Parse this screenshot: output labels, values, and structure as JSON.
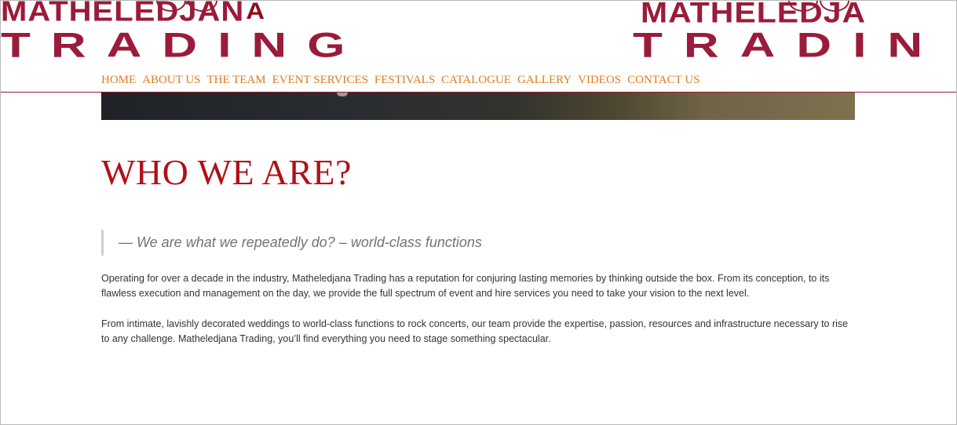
{
  "header": {
    "logo_top_text": "MATHELEDJAN",
    "logo_top_last_letter": "A",
    "logo_bottom_text": "TRADING",
    "logo_repeat_top_text": "MATHELEDJA",
    "logo_repeat_bottom_text": "TRADIN",
    "brand_color": "#9a1b3a"
  },
  "nav": {
    "color": "#e07b1e",
    "items": [
      {
        "label": "HOME"
      },
      {
        "label": "ABOUT US"
      },
      {
        "label": "THE TEAM"
      },
      {
        "label": "EVENT SERVICES"
      },
      {
        "label": "FESTIVALS"
      },
      {
        "label": "CATALOGUE"
      },
      {
        "label": "GALLERY"
      },
      {
        "label": "VIDEOS"
      },
      {
        "label": "CONTACT US"
      }
    ]
  },
  "main": {
    "title": "WHO WE ARE?",
    "title_color": "#b01018",
    "quote": "— We are what we repeatedly do? – world-class functions",
    "paragraphs": [
      "Operating for over a decade in the industry, Matheledjana Trading has a reputation for conjuring lasting memories by thinking outside the box. From its conception, to its flawless execution and management on the day, we provide the full spectrum of event and hire services you need to take your vision to the next level.",
      "From intimate, lavishly decorated weddings to world-class functions to rock concerts, our team provide the expertise, passion, resources and infrastructure necessary to rise to any challenge. Matheledjana Trading, you’ll find everything you need to stage something spectacular."
    ]
  }
}
